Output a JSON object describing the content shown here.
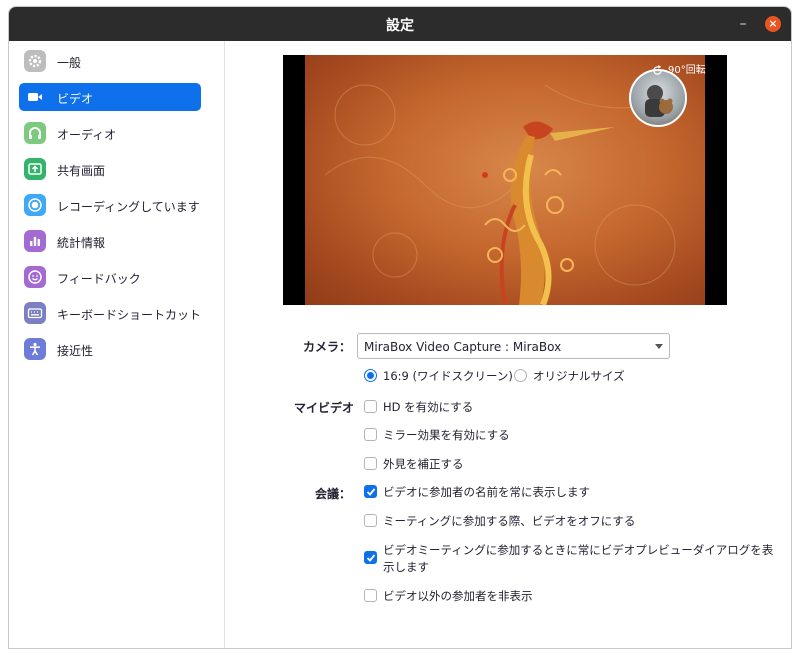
{
  "window": {
    "title": "設定",
    "minimize_glyph": "–",
    "close_glyph": "×"
  },
  "colors": {
    "accent": "#0e71eb",
    "titlebar": "#2c2c2c",
    "close": "#e95420"
  },
  "sidebar": {
    "items": [
      {
        "label": "一般",
        "icon": "gear-icon",
        "color": "#bdbdbd"
      },
      {
        "label": "ビデオ",
        "icon": "video-camera-icon",
        "color": "#ffffff"
      },
      {
        "label": "オーディオ",
        "icon": "headphones-icon",
        "color": "#7cc97f"
      },
      {
        "label": "共有画面",
        "icon": "share-screen-icon",
        "color": "#34b36a"
      },
      {
        "label": "レコーディングしています",
        "icon": "record-icon",
        "color": "#3fa9f5"
      },
      {
        "label": "統計情報",
        "icon": "statistics-icon",
        "color": "#a46ad3"
      },
      {
        "label": "フィードバック",
        "icon": "feedback-icon",
        "color": "#a46ad3"
      },
      {
        "label": "キーボードショートカット",
        "icon": "keyboard-icon",
        "color": "#7b7fc4"
      },
      {
        "label": "接近性",
        "icon": "accessibility-icon",
        "color": "#6d7bd9"
      }
    ],
    "active_index": 1
  },
  "preview": {
    "rotate_label": "90°回転"
  },
  "camera": {
    "label": "カメラ：",
    "selected": "MiraBox Video Capture : MiraBox",
    "aspect_options": [
      {
        "label": "16:9 (ワイドスクリーン)",
        "selected": true
      },
      {
        "label": "オリジナルサイズ",
        "selected": false
      }
    ]
  },
  "my_video": {
    "label": "マイビデオ",
    "options": [
      {
        "label": "HD を有効にする",
        "checked": false
      },
      {
        "label": "ミラー効果を有効にする",
        "checked": false
      },
      {
        "label": "外見を補正する",
        "checked": false
      }
    ]
  },
  "meeting": {
    "label": "会議：",
    "options": [
      {
        "label": "ビデオに参加者の名前を常に表示します",
        "checked": true
      },
      {
        "label": "ミーティングに参加する際、ビデオをオフにする",
        "checked": false
      },
      {
        "label_line1": "ビデオミーティングに参加するときに常にビデオプレビューダイアログを表",
        "label_line2": "示します",
        "checked": true
      },
      {
        "label": "ビデオ以外の参加者を非表示",
        "checked": false
      }
    ]
  }
}
